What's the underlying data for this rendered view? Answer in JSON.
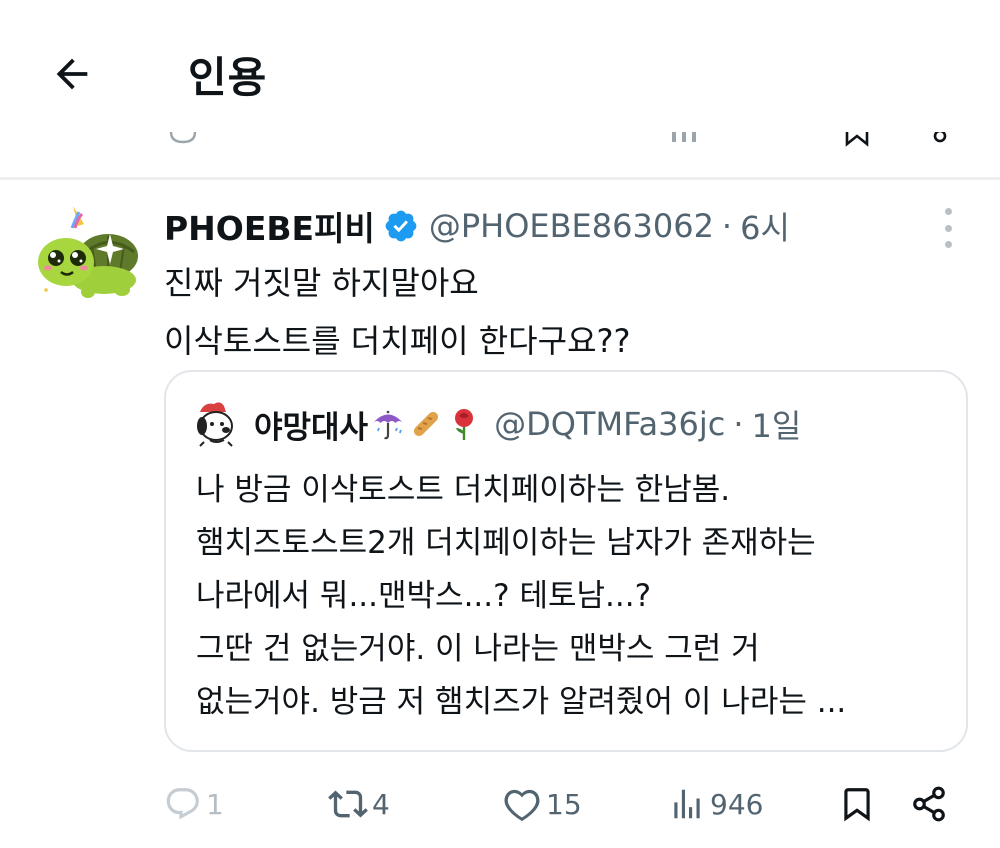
{
  "header": {
    "title": "인용"
  },
  "tweet": {
    "author": {
      "display_name": "PHOEBE피비",
      "handle": "@PHOEBE863062",
      "separator": "·",
      "time": "6시",
      "verified": true
    },
    "text_lines": [
      "진짜 거짓말 하지말아요",
      "이삭토스트를 더치페이 한다구요??"
    ],
    "quoted": {
      "display_name": "야망대사",
      "name_emojis": [
        "umbrella-icon",
        "baguette-icon",
        "rose-icon"
      ],
      "handle": "@DQTMFa36jc",
      "separator": "·",
      "time": "1일",
      "text_lines": [
        "나 방금 이삭토스트 더치페이하는 한남봄.",
        "햄치즈토스트2개 더치페이하는 남자가 존재하는",
        "나라에서 뭐...맨박스...? 테토남...?",
        "그딴 건 없는거야. 이 나라는 맨박스 그런 거",
        "없는거야. 방금 저 햄치즈가 알려줬어 이 나라는 ..."
      ]
    },
    "actions": {
      "replies": "1",
      "retweets": "4",
      "likes": "15",
      "views": "946"
    }
  },
  "colors": {
    "text": "#0f1419",
    "secondary": "#536471",
    "verified": "#1d9bf0",
    "border": "#e2e6ea"
  }
}
